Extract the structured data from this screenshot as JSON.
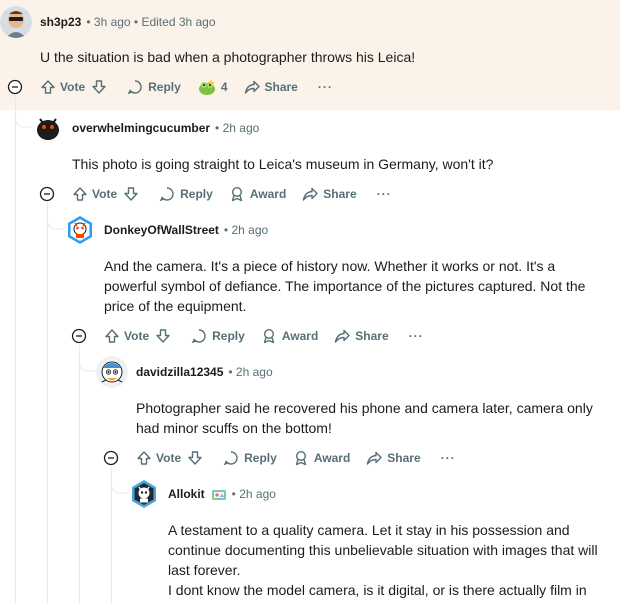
{
  "comments": [
    {
      "author": "sh3p23",
      "meta": "• 3h ago • Edited 3h ago",
      "text": [
        "U the situation is bad when a photographer throws his Leica!"
      ],
      "actions": {
        "vote": "Vote",
        "reply": "Reply",
        "award_count": "4",
        "share": "Share",
        "more": "···"
      }
    },
    {
      "author": "overwhelmingcucumber",
      "meta": "• 2h ago",
      "text": [
        "This photo is going straight to Leica's museum in Germany, won't it?"
      ],
      "actions": {
        "vote": "Vote",
        "reply": "Reply",
        "award": "Award",
        "share": "Share",
        "more": "···"
      }
    },
    {
      "author": "DonkeyOfWallStreet",
      "meta": "• 2h ago",
      "text": [
        "And the camera. It's a piece of history now. Whether it works or not. It's a",
        "powerful symbol of defiance. The importance of the pictures captured. Not the",
        "price of the equipment."
      ],
      "actions": {
        "vote": "Vote",
        "reply": "Reply",
        "award": "Award",
        "share": "Share",
        "more": "···"
      }
    },
    {
      "author": "davidzilla12345",
      "meta": "• 2h ago",
      "text": [
        "Photographer said he recovered his phone and camera later, camera only",
        "had minor scuffs on the bottom!"
      ],
      "actions": {
        "vote": "Vote",
        "reply": "Reply",
        "award": "Award",
        "share": "Share",
        "more": "···"
      }
    },
    {
      "author": "Allokit",
      "meta": "• 2h ago",
      "text": [
        "A testament to a quality camera. Let it stay in his possession and",
        "continue documenting this unbelievable situation with images that will",
        "last forever.",
        "I dont know the model camera, is it digital, or is there actually film in"
      ]
    }
  ],
  "colors": {
    "highlight_bg": "#fbf3ea",
    "thread_line": "#e5ebee",
    "meta_text": "#576f76",
    "body_text": "#1c1c1c"
  },
  "icons": [
    "collapse-icon",
    "upvote-icon",
    "downvote-icon",
    "reply-icon",
    "award-icon",
    "share-icon",
    "more-icon",
    "award-emoji-icon",
    "user-flair-icon"
  ]
}
